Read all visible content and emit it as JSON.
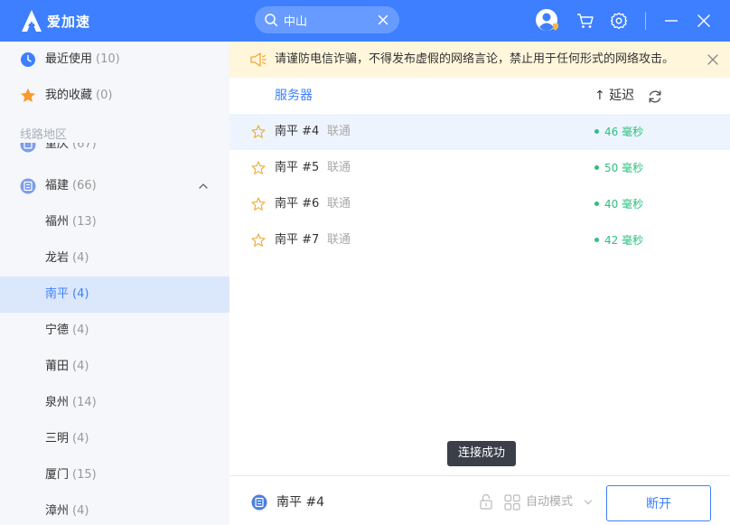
{
  "app": {
    "name": "爱加速"
  },
  "search": {
    "value": "中山",
    "placeholder": ""
  },
  "sidebar": {
    "recent": {
      "label": "最近使用",
      "count": "(10)"
    },
    "favorites": {
      "label": "我的收藏",
      "count": "(0)"
    },
    "section_label": "线路地区",
    "partial": {
      "label": "重庆",
      "count": "(67)"
    },
    "province": {
      "label": "福建",
      "count": "(66)"
    },
    "cities": [
      {
        "label": "福州",
        "count": "(13)"
      },
      {
        "label": "龙岩",
        "count": "(4)"
      },
      {
        "label": "南平",
        "count": "(4)"
      },
      {
        "label": "宁德",
        "count": "(4)"
      },
      {
        "label": "莆田",
        "count": "(4)"
      },
      {
        "label": "泉州",
        "count": "(14)"
      },
      {
        "label": "三明",
        "count": "(4)"
      },
      {
        "label": "厦门",
        "count": "(15)"
      },
      {
        "label": "漳州",
        "count": "(4)"
      }
    ]
  },
  "notice": {
    "text": "请谨防电信诈骗，不得发布虚假的网络言论，禁止用于任何形式的网络攻击。"
  },
  "table": {
    "col_server": "服务器",
    "col_latency": "↑ 延迟",
    "rows": [
      {
        "name": "南平 #4",
        "isp": "联通",
        "latency": "46 毫秒"
      },
      {
        "name": "南平 #5",
        "isp": "联通",
        "latency": "50 毫秒"
      },
      {
        "name": "南平 #6",
        "isp": "联通",
        "latency": "40 毫秒"
      },
      {
        "name": "南平 #7",
        "isp": "联通",
        "latency": "42 毫秒"
      }
    ]
  },
  "toast": "连接成功",
  "footer": {
    "connected": "南平 #4",
    "mode": "自动模式",
    "disconnect": "断开"
  },
  "colors": {
    "brand": "#3d7fff",
    "latency_ok": "#2ec07f",
    "notice_bg": "#fff6dc"
  }
}
